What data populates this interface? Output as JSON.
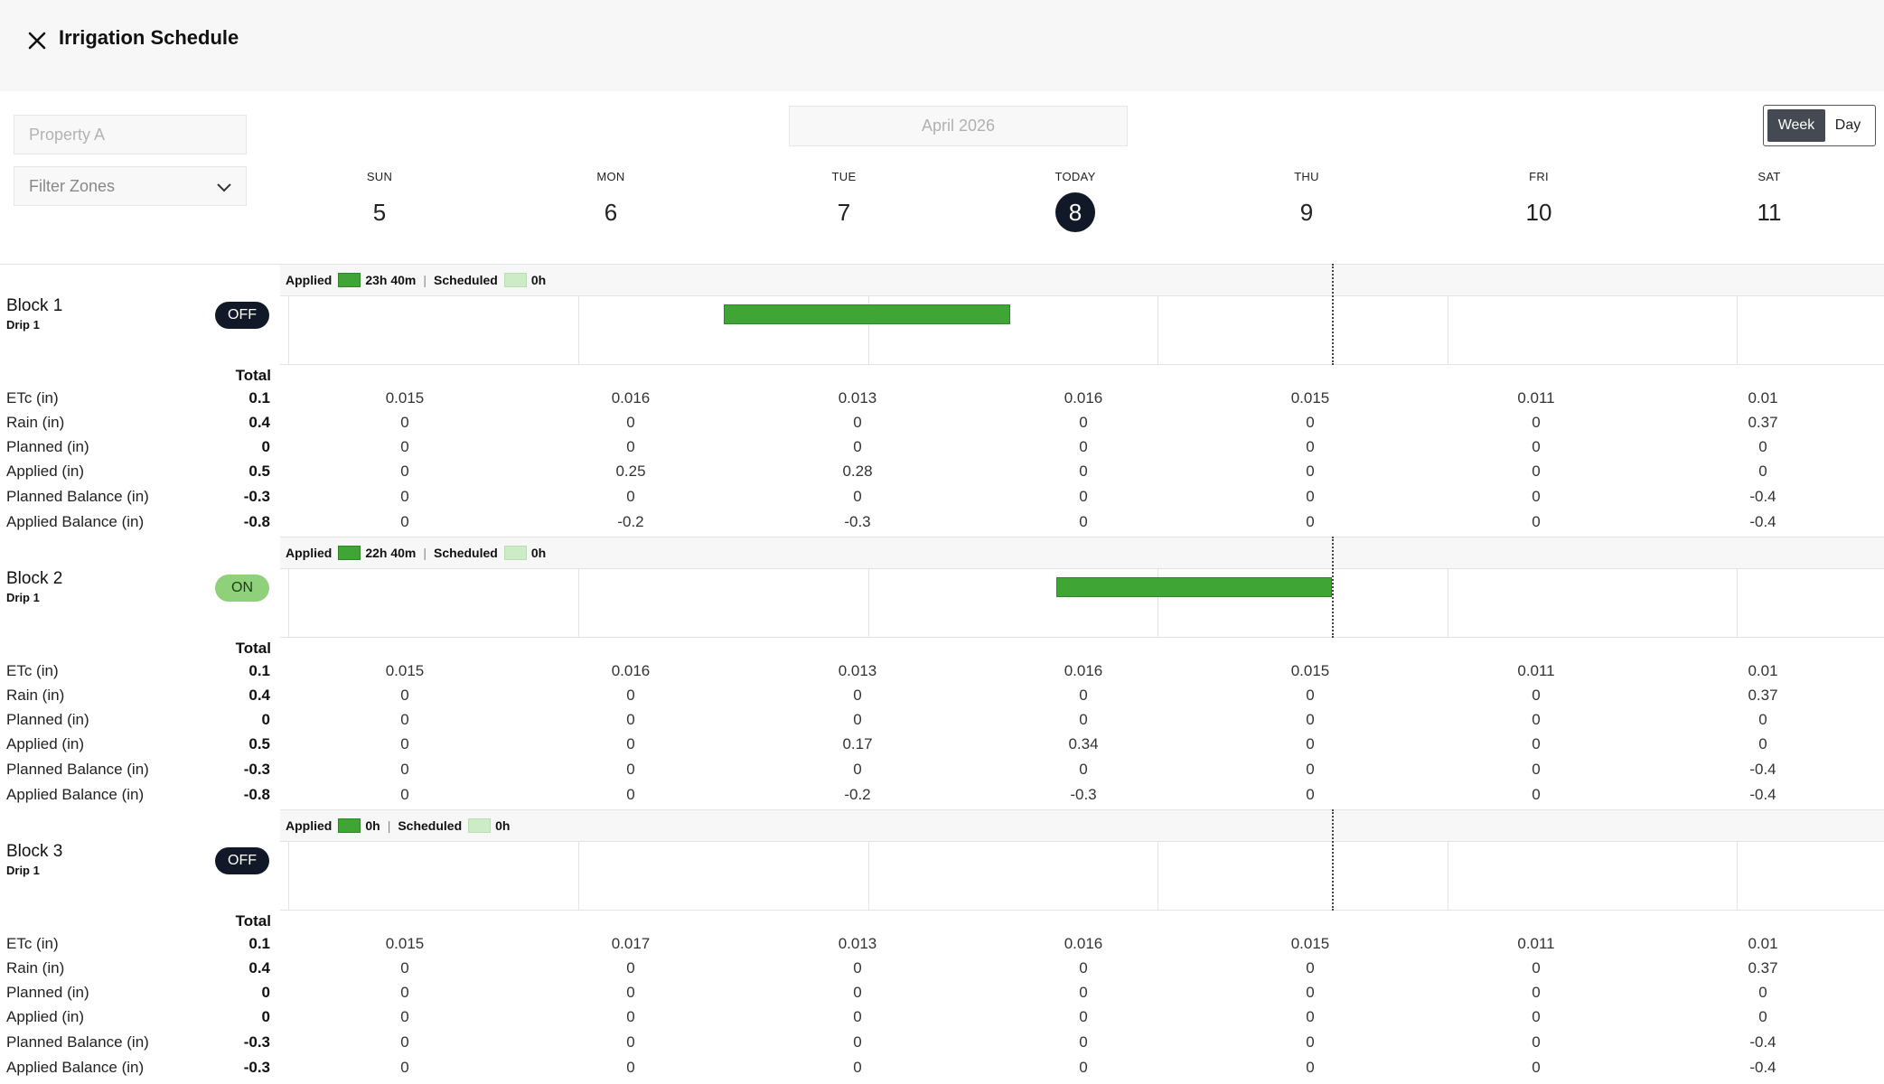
{
  "header": {
    "title": "Irrigation Schedule"
  },
  "filters": {
    "property_placeholder": "Property A",
    "zone_filter_label": "Filter Zones"
  },
  "month_picker": {
    "label": "April 2026"
  },
  "view_toggle": {
    "week": "Week",
    "day": "Day",
    "active": "Week"
  },
  "days": [
    {
      "name": "SUN",
      "num": "5",
      "today": false
    },
    {
      "name": "MON",
      "num": "6",
      "today": false
    },
    {
      "name": "TUE",
      "num": "7",
      "today": false
    },
    {
      "name": "TODAY",
      "num": "8",
      "today": true
    },
    {
      "name": "THU",
      "num": "9",
      "today": false
    },
    {
      "name": "FRI",
      "num": "10",
      "today": false
    },
    {
      "name": "SAT",
      "num": "11",
      "today": false
    }
  ],
  "labels": {
    "total": "Total",
    "applied": "Applied",
    "scheduled": "Scheduled",
    "separator": "|",
    "metrics": [
      "ETc (in)",
      "Rain (in)",
      "Planned (in)",
      "Applied (in)",
      "Planned Balance (in)",
      "Applied Balance (in)"
    ]
  },
  "colors": {
    "applied": "#3fa535",
    "scheduled": "#cdebc7",
    "toggle_off": "#111827",
    "toggle_on": "#8ed17a"
  },
  "blocks": [
    {
      "name": "Block 1",
      "sub": "Drip 1",
      "status": "OFF",
      "applied_total": "23h 40m",
      "scheduled_total": "0h",
      "totals": [
        "0.1",
        "0.4",
        "0",
        "0.5",
        "-0.3",
        "-0.8"
      ],
      "values": [
        [
          "0.015",
          "0.016",
          "0.013",
          "0.016",
          "0.015",
          "0.011",
          "0.01"
        ],
        [
          "0",
          "0",
          "0",
          "0",
          "0",
          "0",
          "0.37"
        ],
        [
          "0",
          "0",
          "0",
          "0",
          "0",
          "0",
          "0"
        ],
        [
          "0",
          "0.25",
          "0.28",
          "0",
          "0",
          "0",
          "0"
        ],
        [
          "0",
          "0",
          "0",
          "0",
          "0",
          "0",
          "-0.4"
        ],
        [
          "0",
          "-0.2",
          "-0.3",
          "0",
          "0",
          "0",
          "-0.4"
        ]
      ]
    },
    {
      "name": "Block 2",
      "sub": "Drip 1",
      "status": "ON",
      "applied_total": "22h 40m",
      "scheduled_total": "0h",
      "totals": [
        "0.1",
        "0.4",
        "0",
        "0.5",
        "-0.3",
        "-0.8"
      ],
      "values": [
        [
          "0.015",
          "0.016",
          "0.013",
          "0.016",
          "0.015",
          "0.011",
          "0.01"
        ],
        [
          "0",
          "0",
          "0",
          "0",
          "0",
          "0",
          "0.37"
        ],
        [
          "0",
          "0",
          "0",
          "0",
          "0",
          "0",
          "0"
        ],
        [
          "0",
          "0",
          "0.17",
          "0.34",
          "0",
          "0",
          "0"
        ],
        [
          "0",
          "0",
          "0",
          "0",
          "0",
          "0",
          "-0.4"
        ],
        [
          "0",
          "0",
          "-0.2",
          "-0.3",
          "0",
          "0",
          "-0.4"
        ]
      ]
    },
    {
      "name": "Block 3",
      "sub": "Drip 1",
      "status": "OFF",
      "applied_total": "0h",
      "scheduled_total": "0h",
      "totals": [
        "0.1",
        "0.4",
        "0",
        "0",
        "-0.3",
        "-0.3"
      ],
      "values": [
        [
          "0.015",
          "0.017",
          "0.013",
          "0.016",
          "0.015",
          "0.011",
          "0.01"
        ],
        [
          "0",
          "0",
          "0",
          "0",
          "0",
          "0",
          "0.37"
        ],
        [
          "0",
          "0",
          "0",
          "0",
          "0",
          "0",
          "0"
        ],
        [
          "0",
          "0",
          "0",
          "0",
          "0",
          "0",
          "0"
        ],
        [
          "0",
          "0",
          "0",
          "0",
          "0",
          "0",
          "-0.4"
        ],
        [
          "0",
          "0",
          "0",
          "0",
          "0",
          "0",
          "-0.4"
        ]
      ]
    }
  ]
}
